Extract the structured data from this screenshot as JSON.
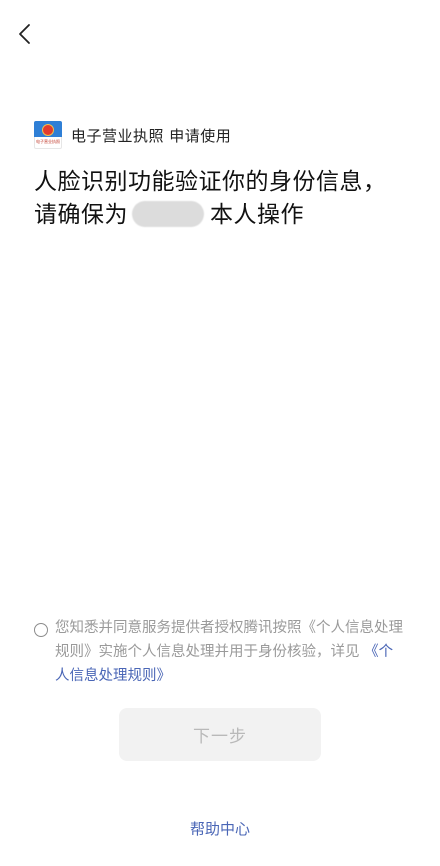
{
  "nav": {
    "back_icon": "chevron-left-icon"
  },
  "header": {
    "logo_icon": "business-license-emblem-icon",
    "logo_text": "电子营业执照",
    "app_name": "电子营业执照 申请使用"
  },
  "title": {
    "line1": "人脸识别功能验证你的身份信息，",
    "line2_prefix": "请确保为",
    "line2_suffix": "本人操作"
  },
  "consent": {
    "text_main": "您知悉并同意服务提供者授权腾讯按照《个人信息处理规则》实施个人信息处理并用于身份核验，详见",
    "link_text": "《个人信息处理规则》",
    "checked": false
  },
  "actions": {
    "next_label": "下一步",
    "help_label": "帮助中心"
  },
  "colors": {
    "link": "#4a66b6",
    "button_bg": "#f2f2f2",
    "button_text": "#b9b9b9",
    "muted_text": "#9a9a9a"
  }
}
